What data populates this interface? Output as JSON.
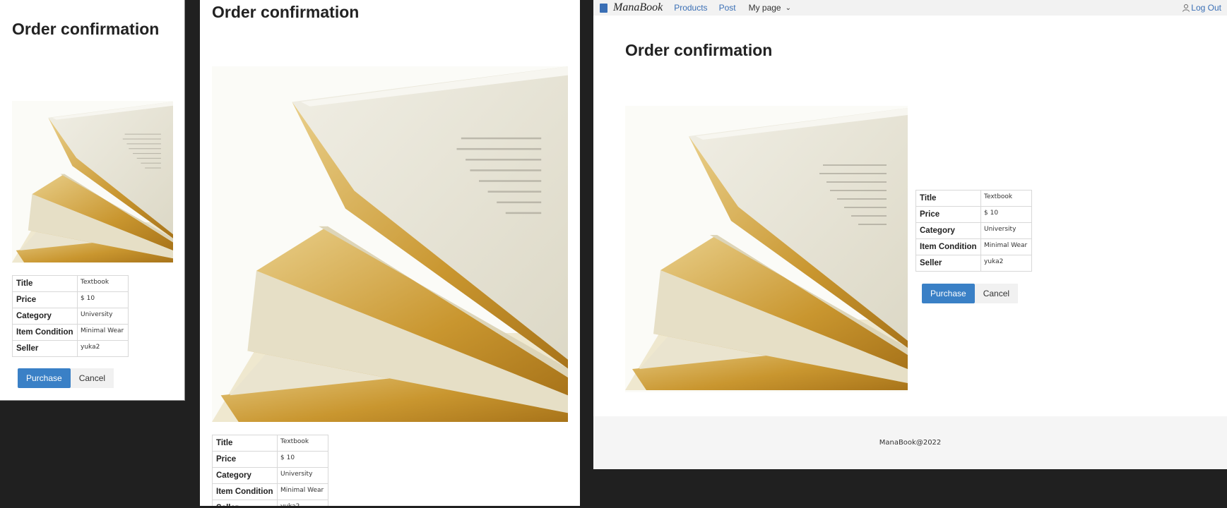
{
  "page": {
    "title": "Order confirmation"
  },
  "navbar": {
    "brand": "ManaBook",
    "links": [
      "Products",
      "Post"
    ],
    "dropdown": "My page",
    "logout": "Log Out"
  },
  "details": [
    {
      "label": "Title",
      "value": "Textbook"
    },
    {
      "label": "Price",
      "value": "$ 10"
    },
    {
      "label": "Category",
      "value": "University"
    },
    {
      "label": "Item Condition",
      "value": "Minimal Wear"
    },
    {
      "label": "Seller",
      "value": "yuka2"
    }
  ],
  "buttons": {
    "purchase": "Purchase",
    "cancel": "Cancel"
  },
  "footer": {
    "text": "ManaBook@2022"
  },
  "icons": {
    "brand": "book-icon",
    "dropdown": "chevron-down-icon",
    "logout": "user-icon"
  },
  "colors": {
    "primary_button": "#3a80c6",
    "link": "#3a6fb5",
    "background": "#202020"
  }
}
